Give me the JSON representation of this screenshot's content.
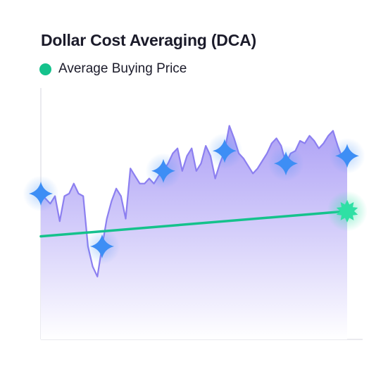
{
  "chart_data": {
    "type": "area",
    "title": "Dollar Cost Averaging (DCA)",
    "xlabel": "",
    "ylabel": "",
    "legend_position": "top-left",
    "grid": false,
    "x": [
      0,
      1,
      2,
      3,
      4,
      5,
      6,
      7,
      8,
      9,
      10,
      11,
      12,
      13,
      14,
      15,
      16,
      17,
      18,
      19,
      20,
      21,
      22,
      23,
      24,
      25,
      26,
      27,
      28,
      29,
      30,
      31,
      32,
      33,
      34,
      35,
      36,
      37,
      38,
      39,
      40,
      41,
      42,
      43,
      44,
      45,
      46,
      47,
      48,
      49,
      50,
      51,
      52,
      53,
      54,
      55,
      56,
      57,
      58,
      59,
      60,
      61,
      62,
      63,
      64,
      65
    ],
    "ylim": [
      0,
      100
    ],
    "xlim": [
      0,
      65
    ],
    "series": [
      {
        "values": [
          58,
          56,
          54,
          57,
          47,
          57,
          58,
          62,
          58,
          57,
          37,
          29,
          25,
          37,
          48,
          55,
          60,
          57,
          48,
          68,
          65,
          62,
          62,
          64,
          62,
          65,
          67,
          70,
          74,
          76,
          67,
          73,
          76,
          67,
          70,
          77,
          73,
          64,
          70,
          75,
          85,
          80,
          74,
          72,
          69,
          66,
          68,
          71,
          74,
          78,
          80,
          77,
          70,
          74,
          75,
          79,
          78,
          81,
          79,
          76,
          78,
          81,
          83,
          77,
          72,
          73
        ],
        "color": "#8c7ff0",
        "fill_top": "#a99cf5",
        "fill_bottom": "#ffffff"
      },
      {
        "name": "Average Buying Price",
        "values_at_x": [
          [
            0,
            41
          ],
          [
            65,
            51
          ]
        ],
        "color": "#15c28c"
      }
    ],
    "purchase_markers": [
      {
        "x": 0,
        "color": "#3d8ef5"
      },
      {
        "x": 13,
        "color": "#3d8ef5"
      },
      {
        "x": 26,
        "color": "#3d8ef5"
      },
      {
        "x": 39,
        "color": "#3d8ef5"
      },
      {
        "x": 52,
        "color": "#3d8ef5"
      },
      {
        "x": 65,
        "color": "#3d8ef5"
      }
    ],
    "highlight_marker": {
      "x": 65,
      "y": 51,
      "color": "#2ee0a4"
    }
  }
}
